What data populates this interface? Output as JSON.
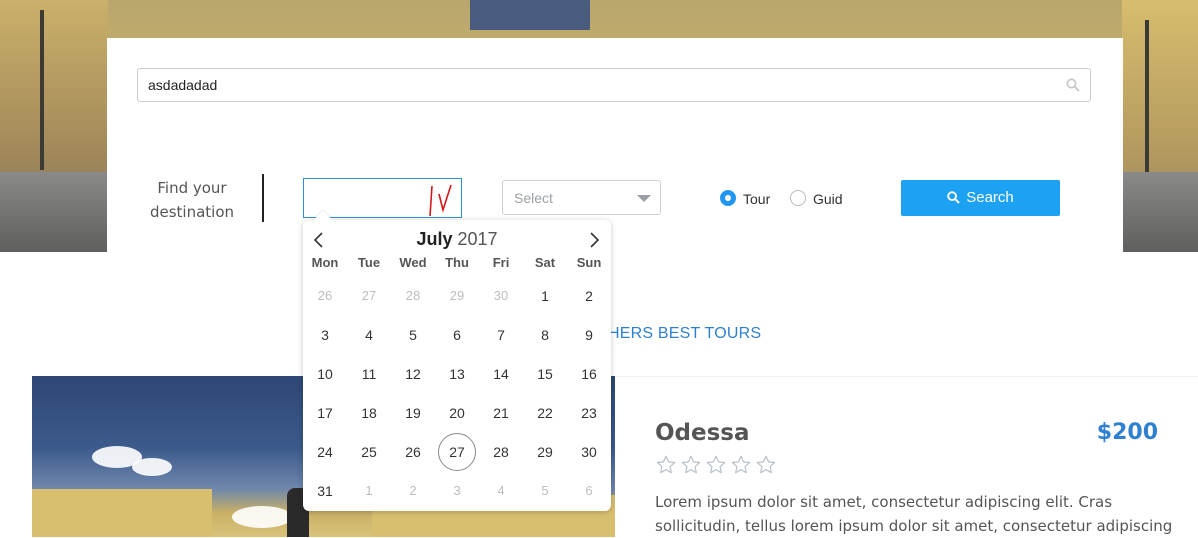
{
  "search": {
    "value": "asdadadad"
  },
  "finder": {
    "label_line1": "Find your",
    "label_line2": "destination",
    "date_value": "",
    "select_placeholder": "Select",
    "radio_tour": "Tour",
    "radio_guid": "Guid",
    "radio_selected": "Tour",
    "search_button": "Search"
  },
  "calendar": {
    "month": "July",
    "year": "2017",
    "weekdays": [
      "Mon",
      "Tue",
      "Wed",
      "Thu",
      "Fri",
      "Sat",
      "Sun"
    ],
    "weeks": [
      [
        {
          "d": "26",
          "muted": true
        },
        {
          "d": "27",
          "muted": true
        },
        {
          "d": "28",
          "muted": true
        },
        {
          "d": "29",
          "muted": true
        },
        {
          "d": "30",
          "muted": true
        },
        {
          "d": "1"
        },
        {
          "d": "2"
        }
      ],
      [
        {
          "d": "3"
        },
        {
          "d": "4"
        },
        {
          "d": "5"
        },
        {
          "d": "6"
        },
        {
          "d": "7"
        },
        {
          "d": "8"
        },
        {
          "d": "9"
        }
      ],
      [
        {
          "d": "10"
        },
        {
          "d": "11"
        },
        {
          "d": "12"
        },
        {
          "d": "13"
        },
        {
          "d": "14"
        },
        {
          "d": "15"
        },
        {
          "d": "16"
        }
      ],
      [
        {
          "d": "17"
        },
        {
          "d": "18"
        },
        {
          "d": "19"
        },
        {
          "d": "20"
        },
        {
          "d": "21"
        },
        {
          "d": "22"
        },
        {
          "d": "23"
        }
      ],
      [
        {
          "d": "24"
        },
        {
          "d": "25"
        },
        {
          "d": "26"
        },
        {
          "d": "27",
          "today": true
        },
        {
          "d": "28"
        },
        {
          "d": "29"
        },
        {
          "d": "30"
        }
      ],
      [
        {
          "d": "31"
        },
        {
          "d": "1",
          "muted": true
        },
        {
          "d": "2",
          "muted": true
        },
        {
          "d": "3",
          "muted": true
        },
        {
          "d": "4",
          "muted": true
        },
        {
          "d": "5",
          "muted": true
        },
        {
          "d": "6",
          "muted": true
        }
      ]
    ]
  },
  "section": {
    "title": "HERS BEST TOURS"
  },
  "card": {
    "title": "Odessa",
    "price": "$200",
    "rating": 0,
    "rating_max": 5,
    "description": "Lorem ipsum dolor sit amet, consectetur adipiscing elit. Cras sollicitudin, tellus lorem ipsum dolor sit amet, consectetur adipiscing"
  },
  "colors": {
    "accent": "#1da1f2",
    "link": "#2f80d1",
    "radio_active": "#2196f3"
  },
  "icons": {
    "search_field": "magnifier-icon",
    "search_button": "magnifier-icon",
    "prev": "chevron-left-icon",
    "next": "chevron-right-icon",
    "star": "star-outline-icon"
  }
}
